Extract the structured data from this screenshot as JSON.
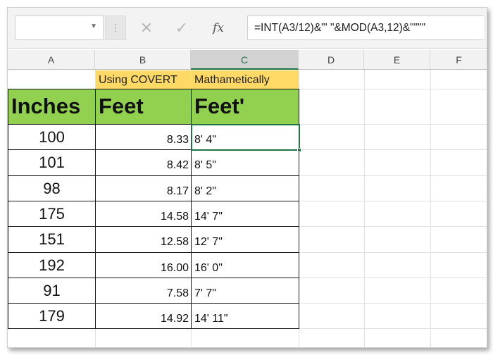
{
  "formula_bar": {
    "name_box": "",
    "dots_icon": "vertical-dots-icon",
    "cancel_icon": "x-icon",
    "enter_icon": "checkmark-icon",
    "fx_label": "fx",
    "formula": "=INT(A3/12)&\"' \"&MOD(A3,12)&\"\"\"\""
  },
  "columns": [
    "A",
    "B",
    "C",
    "D",
    "E",
    "F"
  ],
  "selected_column": "C",
  "row1": {
    "b": "Using COVERT",
    "c": "Mathametically"
  },
  "row2": {
    "a": "Inches",
    "b": "Feet",
    "c": "Feet'"
  },
  "rows": [
    {
      "inches": "100",
      "feet": "8.33",
      "feet_text": "8' 4\""
    },
    {
      "inches": "101",
      "feet": "8.42",
      "feet_text": "8' 5\""
    },
    {
      "inches": "98",
      "feet": "8.17",
      "feet_text": "8' 2\""
    },
    {
      "inches": "175",
      "feet": "14.58",
      "feet_text": "14' 7\""
    },
    {
      "inches": "151",
      "feet": "12.58",
      "feet_text": "12' 7\""
    },
    {
      "inches": "192",
      "feet": "16.00",
      "feet_text": "16' 0\""
    },
    {
      "inches": "91",
      "feet": "7.58",
      "feet_text": "7' 7\""
    },
    {
      "inches": "179",
      "feet": "14.92",
      "feet_text": "14' 11\""
    }
  ],
  "colors": {
    "header_yellow": "#ffd966",
    "header_green": "#92d050",
    "selection_green": "#217346"
  }
}
